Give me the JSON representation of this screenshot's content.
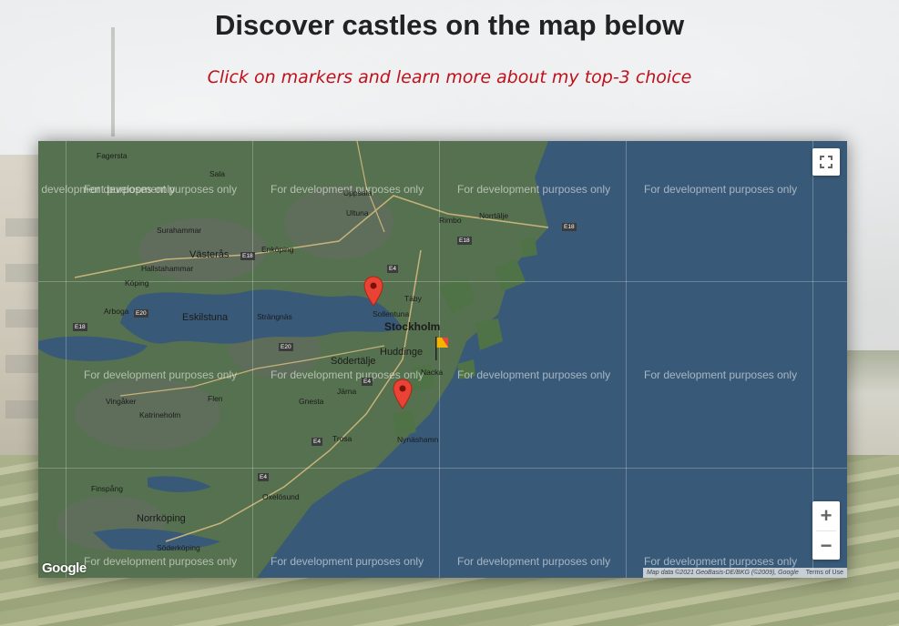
{
  "page": {
    "title": "Discover castles on the map below",
    "subtitle": "Click on markers and learn more about my top-3 choice"
  },
  "map": {
    "dev_watermark": "For development purposes only",
    "controls": {
      "fullscreen_icon": "fullscreen-icon",
      "zoom_in": "+",
      "zoom_out": "−"
    },
    "attribution": {
      "data": "Map data ©2021 GeoBasis-DE/BKG (©2009), Google",
      "terms": "Terms of Use"
    },
    "logo": "Google",
    "places": [
      "Fagersta",
      "Sala",
      "Uppsala",
      "Ultuna",
      "Rimbo",
      "Norrtälje",
      "Surahammar",
      "Västerås",
      "Enköping",
      "Hallstahammar",
      "Köping",
      "Arboga",
      "Eskilstuna",
      "Strängnäs",
      "Sollentuna",
      "Täby",
      "Stockholm",
      "Huddinge",
      "Södertälje",
      "Järna",
      "Vingåker",
      "Flen",
      "Katrineholm",
      "Gnesta",
      "Trosa",
      "Nynäshamn",
      "Finspång",
      "Oxelösund",
      "Norrköping",
      "Söderköping",
      "Nacka"
    ],
    "roads": [
      "E18",
      "E18",
      "E18",
      "E4",
      "E4",
      "E20",
      "E20",
      "E18",
      "E4",
      "E4"
    ],
    "markers": [
      {
        "type": "castle-marker",
        "color": "#ea4335"
      },
      {
        "type": "castle-marker",
        "color": "#ea4335"
      }
    ],
    "flag": {
      "type": "start-flag",
      "color": "#f4b400"
    }
  }
}
